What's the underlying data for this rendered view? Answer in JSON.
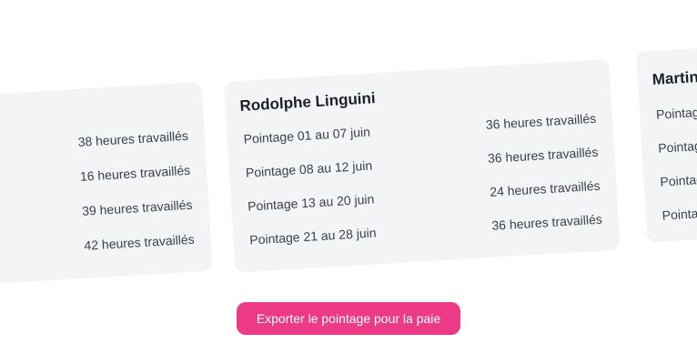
{
  "cards": [
    {
      "name": "",
      "rows": [
        {
          "label": "",
          "value": "38 heures travaillés"
        },
        {
          "label": "",
          "value": "16 heures travaillés"
        },
        {
          "label": "",
          "value": "39 heures travaillés"
        },
        {
          "label": "",
          "value": "42 heures travaillés"
        }
      ]
    },
    {
      "name": "Rodolphe Linguini",
      "rows": [
        {
          "label": "Pointage 01 au 07 juin",
          "value": "36 heures travaillés"
        },
        {
          "label": "Pointage 08 au 12 juin",
          "value": "36 heures travaillés"
        },
        {
          "label": "Pointage 13 au 20 juin",
          "value": "24 heures travaillés"
        },
        {
          "label": "Pointage 21 au 28 juin",
          "value": "36 heures travaillés"
        }
      ]
    },
    {
      "name": "Martin",
      "rows": [
        {
          "label": "Pointage",
          "value": ""
        },
        {
          "label": "Pointag",
          "value": ""
        },
        {
          "label": "Pointag",
          "value": ""
        },
        {
          "label": "Pointa",
          "value": ""
        }
      ]
    }
  ],
  "export_button": {
    "label": "Exporter le pointage pour la paie"
  },
  "colors": {
    "card_background": "#f3f4f6",
    "accent": "#ec3a86",
    "text": "#3a414b"
  }
}
